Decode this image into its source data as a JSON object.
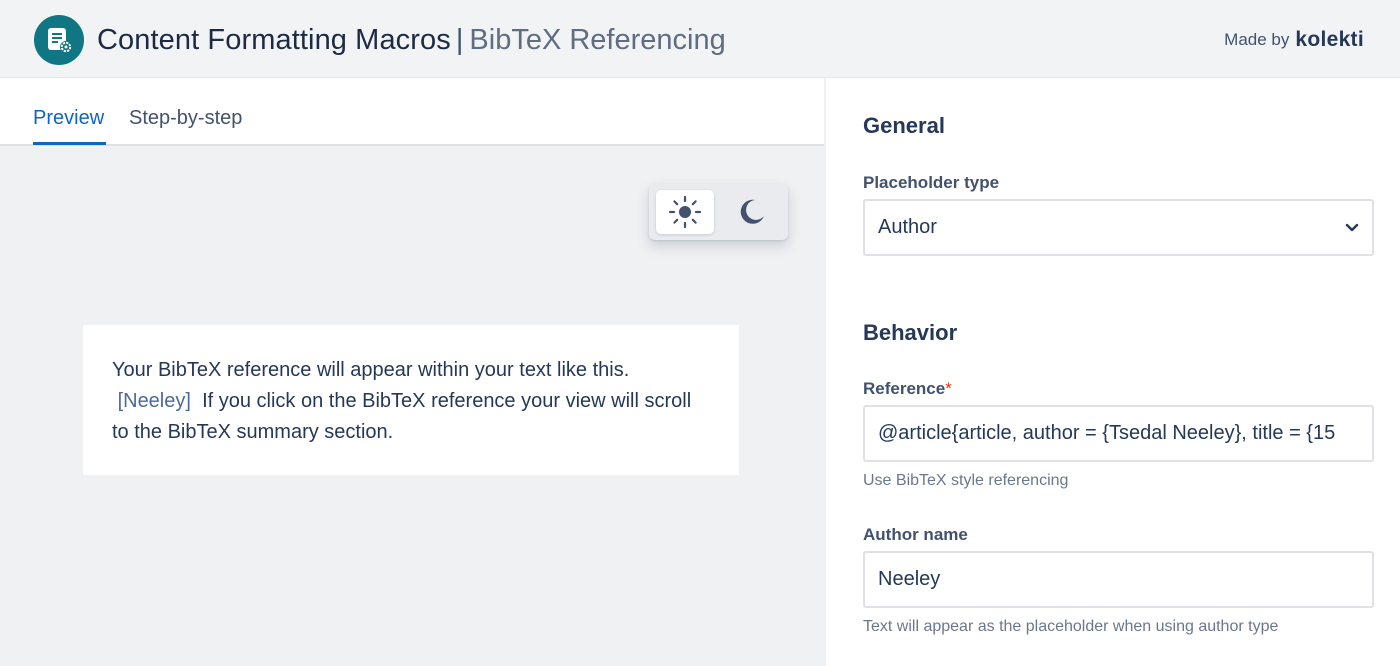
{
  "header": {
    "title_main": "Content Formatting Macros",
    "title_separator": "|",
    "title_sub": "BibTeX Referencing",
    "made_by": "Made by",
    "brand": "kolekti",
    "logo_icon": "macro-settings-icon"
  },
  "tabs": [
    {
      "label": "Preview",
      "active": true
    },
    {
      "label": "Step-by-step",
      "active": false
    }
  ],
  "theme_toggle": {
    "light_icon": "sun-icon",
    "dark_icon": "moon-icon",
    "selected": "light"
  },
  "preview": {
    "text_before": "Your BibTeX reference will appear within your text like this.",
    "reference_link": "[Neeley]",
    "text_after": "If you click on the BibTeX reference your view will scroll to the BibTeX summary section."
  },
  "settings": {
    "general": {
      "title": "General",
      "placeholder_type_label": "Placeholder type",
      "placeholder_type_value": "Author"
    },
    "behavior": {
      "title": "Behavior",
      "reference_label": "Reference",
      "reference_required_mark": "*",
      "reference_value": "@article{article,   author = {Tsedal Neeley},   title = {15",
      "reference_helper": "Use BibTeX style referencing",
      "author_name_label": "Author name",
      "author_name_value": "Neeley",
      "author_name_helper": "Text will appear as the placeholder when using author type"
    }
  },
  "colors": {
    "accent": "#0c66c2",
    "logo_bg": "#107683",
    "required": "#de350b"
  }
}
